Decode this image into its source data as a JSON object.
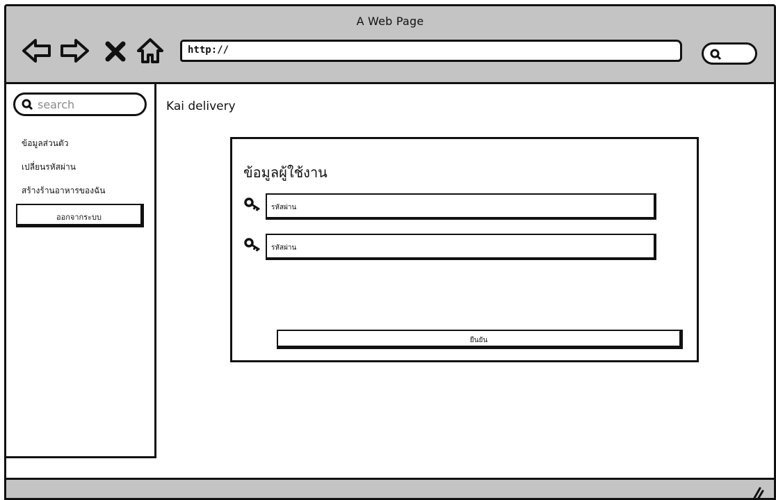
{
  "window": {
    "title": "A Web Page"
  },
  "toolbar": {
    "url": "http://",
    "icons": [
      "back-arrow-icon",
      "forward-arrow-icon",
      "close-icon",
      "home-icon",
      "search-icon"
    ]
  },
  "sidebar": {
    "search_placeholder": "search",
    "items": [
      {
        "label": "ข้อมูลส่วนตัว"
      },
      {
        "label": "เปลี่ยนรหัสผ่าน"
      },
      {
        "label": "สร้างร้านอาหารของฉัน"
      }
    ],
    "logout_label": "ออกจากระบบ"
  },
  "main": {
    "heading": "Kai delivery",
    "card": {
      "title": "ข้อมูลผู้ใช้งาน",
      "fields": [
        {
          "value": "รหัสผ่าน",
          "icon": "key-icon"
        },
        {
          "value": "รหัสผ่าน",
          "icon": "key-icon"
        }
      ],
      "confirm_label": "ยืนยัน"
    }
  }
}
